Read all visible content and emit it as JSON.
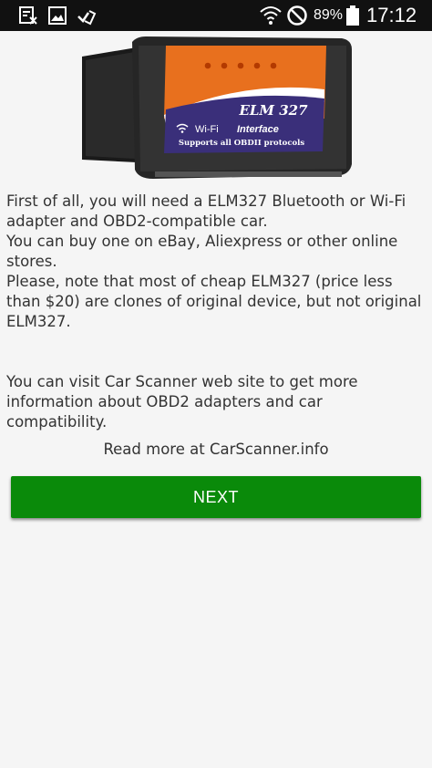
{
  "status_bar": {
    "battery_percent": "89%",
    "time": "17:12",
    "left_icons": [
      "notification-doc-icon",
      "image-icon",
      "checkmark-clipboard-icon"
    ],
    "right_icons": [
      "wifi-icon",
      "do-not-disturb-icon",
      "battery-icon"
    ]
  },
  "device_image": {
    "label_main": "ELM 327",
    "label_wifi": "Wi-Fi",
    "label_interface": "Interface",
    "label_protocols": "Supports all OBDII protocols"
  },
  "content": {
    "paragraph1": "First of all, you will need a ELM327 Bluetooth or Wi-Fi adapter and OBD2-compatible car.",
    "paragraph2": "You can buy one on eBay, Aliexpress or other online stores.",
    "paragraph3": "Please, note that most of cheap ELM327 (price less than $20) are clones of original device, but not original ELM327.",
    "paragraph4": "You can visit Car Scanner web site to get more information about OBD2 adapters and car compatibility.",
    "read_more": "Read more at CarScanner.info"
  },
  "buttons": {
    "next_label": "NEXT"
  },
  "colors": {
    "status_bar_bg": "#111111",
    "background": "#f5f5f5",
    "next_button": "#0a8a0a",
    "adapter_orange": "#e8701e",
    "adapter_purple": "#3a2f7a"
  }
}
